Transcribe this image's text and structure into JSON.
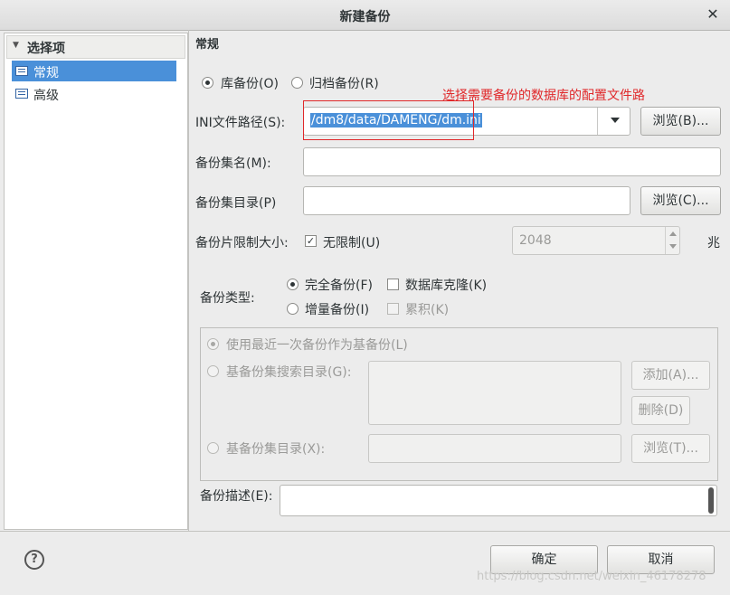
{
  "window": {
    "title": "新建备份",
    "close_glyph": "✕"
  },
  "sidebar": {
    "header": "选择项",
    "items": [
      {
        "label": "常规",
        "selected": true
      },
      {
        "label": "高级",
        "selected": false
      }
    ]
  },
  "section": {
    "title": "常规"
  },
  "backup_mode": {
    "options": [
      {
        "label": "库备份(O)",
        "checked": true
      },
      {
        "label": "归档备份(R)",
        "checked": false
      }
    ]
  },
  "annotation": {
    "text": "选择需要备份的数据库的配置文件路"
  },
  "ini_path": {
    "label": "INI文件路径(S):",
    "value": "/dm8/data/DAMENG/dm.ini",
    "browse": "浏览(B)..."
  },
  "backup_set_name": {
    "label": "备份集名(M):",
    "value": ""
  },
  "backup_set_dir": {
    "label": "备份集目录(P)",
    "value": "",
    "browse": "浏览(C)..."
  },
  "piece_size": {
    "label": "备份片限制大小:",
    "unlimited_label": "无限制(U)",
    "unlimited": true,
    "value": "2048",
    "unit": "兆"
  },
  "backup_type": {
    "label": "备份类型:",
    "full": "完全备份(F)",
    "clone": "数据库克隆(K)",
    "incremental": "增量备份(I)",
    "cumulative": "累积(K)"
  },
  "base": {
    "use_latest": "使用最近一次备份作为基备份(L)",
    "search_dir": "基备份集搜索目录(G):",
    "add": "添加(A)...",
    "delete": "删除(D)",
    "base_dir": "基备份集目录(X):",
    "browse": "浏览(T)..."
  },
  "description": {
    "label": "备份描述(E):",
    "value": ""
  },
  "footer": {
    "ok": "确定",
    "cancel": "取消",
    "help_glyph": "?"
  },
  "watermark": "https://blog.csdn.net/weixin_46178278",
  "colors": {
    "selection": "#4a90d9",
    "annotation": "#e0282a"
  }
}
